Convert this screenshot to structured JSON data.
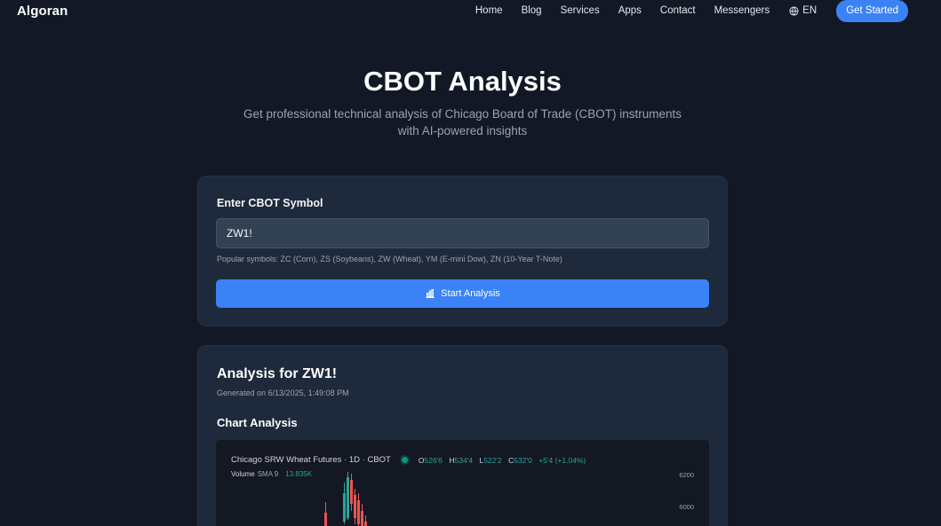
{
  "nav": {
    "logo": "Algoran",
    "links": [
      "Home",
      "Blog",
      "Services",
      "Apps",
      "Contact",
      "Messengers"
    ],
    "language": "EN",
    "cta_label": "Get Started"
  },
  "hero": {
    "title": "CBOT Analysis",
    "subtitle": "Get professional technical analysis of Chicago Board of Trade (CBOT) instruments with AI-powered insights"
  },
  "form": {
    "label": "Enter CBOT Symbol",
    "value": "ZW1!",
    "hint": "Popular symbols: ZC (Corn), ZS (Soybeans), ZW (Wheat), YM (E-mini Dow), ZN (10-Year T-Note)",
    "button_label": "Start Analysis"
  },
  "result": {
    "title": "Analysis for ZW1!",
    "generated": "Generated on 6/13/2025, 1:49:08 PM",
    "chart_section_title": "Chart Analysis"
  },
  "chart": {
    "header": "Chicago SRW Wheat Futures · 1D · CBOT",
    "ohlc": {
      "o_label": "O",
      "o": "526'6",
      "h_label": "H",
      "h": "534'4",
      "l_label": "L",
      "l": "522'2",
      "c_label": "C",
      "c": "532'0",
      "change": "+5'4 (+1.04%)"
    },
    "volume_label": "Volume",
    "volume_sma": "SMA 9",
    "volume_value": "13.835K",
    "y_ticks": [
      "6200",
      "6000"
    ]
  },
  "colors": {
    "accent": "#3b82f6",
    "up": "#26a69a",
    "down": "#ef5350"
  },
  "chart_data": {
    "type": "candlestick",
    "y_ticks": [
      6200,
      6000
    ]
  }
}
